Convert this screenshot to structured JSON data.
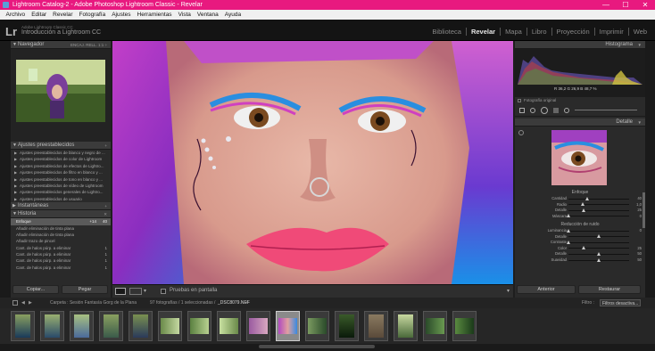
{
  "window": {
    "title": "Lightroom Catalog-2 - Adobe Photoshop Lightroom Classic - Revelar",
    "minimize": "—",
    "maximize": "☐",
    "close": "✕"
  },
  "menu": [
    "Archivo",
    "Editar",
    "Revelar",
    "Fotografía",
    "Ajustes",
    "Herramientas",
    "Vista",
    "Ventana",
    "Ayuda"
  ],
  "identity": {
    "logo": "Lr",
    "catalog_small": "Adobe Lightroom Classic CC",
    "catalog_name": "Introducción a Lightroom CC"
  },
  "modules": [
    {
      "label": "Biblioteca",
      "active": false
    },
    {
      "label": "Revelar",
      "active": true
    },
    {
      "label": "Mapa",
      "active": false
    },
    {
      "label": "Libro",
      "active": false
    },
    {
      "label": "Proyección",
      "active": false
    },
    {
      "label": "Imprimir",
      "active": false
    },
    {
      "label": "Web",
      "active": false
    }
  ],
  "navigator": {
    "title": "Navegador",
    "options": "ENCAJ.  RELL.  1:1  ÷"
  },
  "presets": {
    "title": "Ajustes preestablecidos",
    "items": [
      "Ajustes preestablecidos de blanco y negro de ...",
      "Ajustes preestablecidos de color de Lightroom",
      "Ajustes preestablecidos de efectos de Lightro...",
      "Ajustes preestablecidos de filtro en blanco y ...",
      "Ajustes preestablecidos de tono en blanco y ...",
      "Ajustes preestablecidos de vídeo de Lightroom",
      "Ajustes preestablecidos generales de Lightro...",
      "Ajustes preestablecidos de usuario"
    ]
  },
  "snapshots": {
    "title": "Instantáneas"
  },
  "history": {
    "title": "Historia",
    "items": [
      {
        "label": "Enfoque",
        "v1": "+14",
        "v2": "40",
        "selected": true
      },
      {
        "label": "Añadir eliminación de tinta plana",
        "v1": "",
        "v2": "",
        "selected": false
      },
      {
        "label": "Añadir eliminación de tinta plana",
        "v1": "",
        "v2": "",
        "selected": false
      },
      {
        "label": "Añadir trazo de pincel",
        "v1": "",
        "v2": "",
        "selected": false
      },
      {
        "label": "Cant. de halos púrp. a eliminar",
        "v1": "",
        "v2": "1",
        "selected": false
      },
      {
        "label": "Cant. de halos púrp. a eliminar",
        "v1": "",
        "v2": "1",
        "selected": false
      },
      {
        "label": "Cant. de halos púrp. a eliminar",
        "v1": "",
        "v2": "1",
        "selected": false
      },
      {
        "label": "Cant. de halos púrp. a eliminar",
        "v1": "",
        "v2": "1",
        "selected": false
      }
    ]
  },
  "left_buttons": {
    "copy": "Copiar...",
    "paste": "Pegar"
  },
  "histogram": {
    "title": "Histograma",
    "readout": "R  36,2  G  26,9  B  48,7 %",
    "original_label": "Fotografía original"
  },
  "detail": {
    "title": "Detalle",
    "sharpening_title": "Enfoque",
    "sharpening": [
      {
        "label": "Cantidad",
        "value": "40",
        "level": 0.31
      },
      {
        "label": "Radio",
        "value": "1,0",
        "level": 0.23
      },
      {
        "label": "Detalle",
        "value": "25",
        "level": 0.25
      },
      {
        "label": "Máscara",
        "value": "0",
        "level": 0.0
      }
    ],
    "noise_title": "Reducción de ruido",
    "noise": [
      {
        "label": "Luminancia",
        "value": "0",
        "level": 0.0
      },
      {
        "label": "Detalle",
        "value": "",
        "level": 0.5
      },
      {
        "label": "Contraste",
        "value": "",
        "level": 0.0
      },
      {
        "label": "Color",
        "value": "25",
        "level": 0.25
      },
      {
        "label": "Detalle",
        "value": "50",
        "level": 0.5
      },
      {
        "label": "Suavidad",
        "value": "50",
        "level": 0.5
      }
    ]
  },
  "right_buttons": {
    "previous": "Anterior",
    "reset": "Restaurar"
  },
  "toolbar": {
    "soft_proof": "Pruebas en pantalla"
  },
  "filmstrip_header": {
    "folder_label": "Carpeta : Sesión Fantasía Gorg de la Plana",
    "count": "97 fotografías / 1 seleccionadas /",
    "filename": "_DSC8079.NEF",
    "filter_label": "Filtro :",
    "filter_value": "Filtros desactiva..."
  },
  "filmstrip": {
    "count": 16,
    "selected_index": 10
  },
  "colors": {
    "accent": "#e8197f",
    "panel": "#2a2a2a",
    "header": "#3b3b3b"
  }
}
